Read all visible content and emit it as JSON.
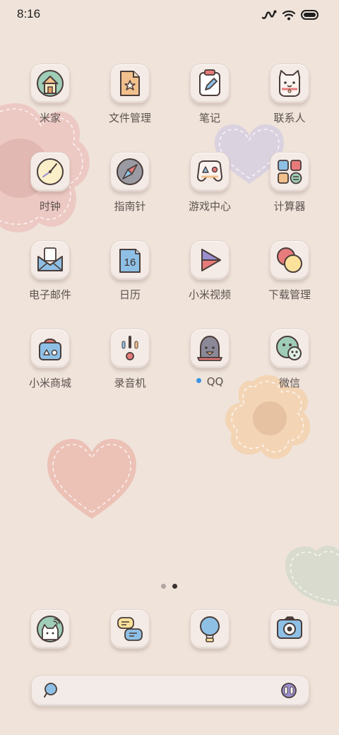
{
  "status_bar": {
    "time": "8:16",
    "icons": [
      "activity-icon",
      "wifi-icon",
      "battery-icon"
    ]
  },
  "apps": [
    {
      "label": "米家",
      "icon": "mijia-house-icon"
    },
    {
      "label": "文件管理",
      "icon": "file-manager-icon"
    },
    {
      "label": "笔记",
      "icon": "notes-icon"
    },
    {
      "label": "联系人",
      "icon": "contacts-cat-icon"
    },
    {
      "label": "时钟",
      "icon": "clock-icon"
    },
    {
      "label": "指南针",
      "icon": "compass-icon"
    },
    {
      "label": "游戏中心",
      "icon": "game-center-icon"
    },
    {
      "label": "计算器",
      "icon": "calculator-icon"
    },
    {
      "label": "电子邮件",
      "icon": "email-icon"
    },
    {
      "label": "日历",
      "icon": "calendar-icon",
      "badge": "16"
    },
    {
      "label": "小米视频",
      "icon": "video-play-icon"
    },
    {
      "label": "下载管理",
      "icon": "download-manager-icon"
    },
    {
      "label": "小米商城",
      "icon": "mi-store-icon"
    },
    {
      "label": "录音机",
      "icon": "recorder-icon"
    },
    {
      "label": "QQ",
      "icon": "qq-penguin-icon",
      "new_indicator": true
    },
    {
      "label": "微信",
      "icon": "wechat-icon"
    }
  ],
  "page_indicator": {
    "pages": 2,
    "current": 2
  },
  "dock": [
    {
      "icon": "phone-cat-icon"
    },
    {
      "icon": "messages-icon"
    },
    {
      "icon": "browser-balloon-icon"
    },
    {
      "icon": "camera-icon"
    }
  ],
  "search_bar": {
    "left_icon": "search-icon",
    "right_icon": "voice-assistant-icon"
  },
  "colors": {
    "background": "#efe3da",
    "tile": "#f4ebe6",
    "label": "#5d534f",
    "qq_dot": "#3b94e8"
  }
}
